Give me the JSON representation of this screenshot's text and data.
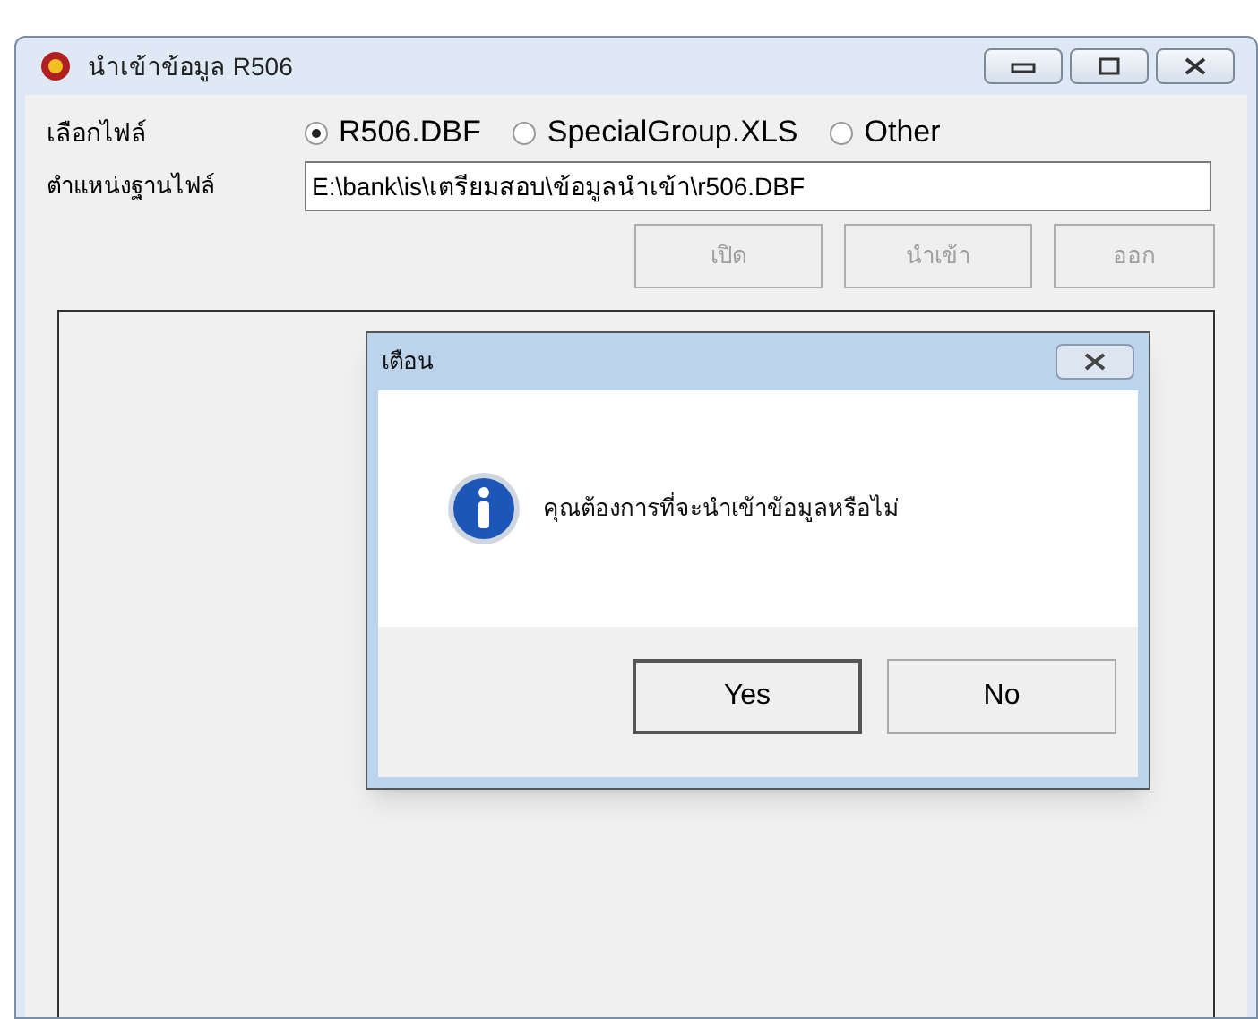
{
  "window": {
    "title": "นำเข้าข้อมูล R506"
  },
  "file_choice": {
    "label": "เลือกไฟล์",
    "options": [
      {
        "label": "R506.DBF",
        "selected": true
      },
      {
        "label": "SpecialGroup.XLS",
        "selected": false
      },
      {
        "label": "Other",
        "selected": false
      }
    ]
  },
  "file_path": {
    "label": "ตำแหน่งฐานไฟล์",
    "value": "E:\\bank\\is\\เตรียมสอบ\\ข้อมูลนำเข้า\\r506.DBF"
  },
  "buttons": [
    {
      "label": "เปิด",
      "disabled": true
    },
    {
      "label": "นำเข้า",
      "disabled": true
    },
    {
      "label": "ออก",
      "disabled": true
    }
  ],
  "dialog": {
    "title": "เตือน",
    "message": "คุณต้องการที่จะนำเข้าข้อมูลหรือไม่",
    "buttons": [
      {
        "label": "Yes",
        "selected": true
      },
      {
        "label": "No",
        "selected": false
      }
    ]
  }
}
